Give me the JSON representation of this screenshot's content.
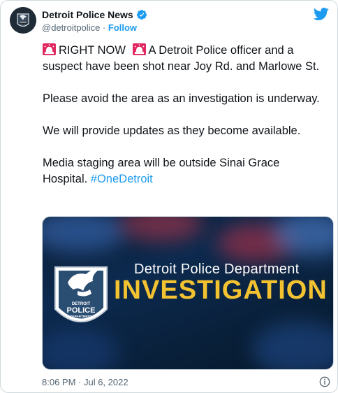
{
  "author": {
    "name": "Detroit Police News",
    "handle": "@detroitpolice",
    "separator": "·",
    "follow_label": "Follow",
    "avatar_icon": "detroit-police-badge-icon",
    "verified_icon": "verified-badge-icon"
  },
  "tweet": {
    "paragraphs": [
      "RIGHT NOW",
      "A Detroit Police officer and a suspect have been shot near Joy Rd. and Marlowe St.",
      "Please avoid the area as an investigation is underway.",
      "We will provide updates as they become available.",
      "Media staging area will be outside Sinai Grace Hospital."
    ],
    "hashtag": "#OneDetroit",
    "emoji": "police-car-light-icon"
  },
  "media": {
    "subtitle": "Detroit Police Department",
    "headline": "INVESTIGATION",
    "badge_line1": "DETROIT",
    "badge_line2": "POLICE",
    "badge_line3": "DEPARTMENT"
  },
  "footer": {
    "timestamp": "8:06 PM · Jul 6, 2022",
    "info_icon": "info-icon"
  },
  "colors": {
    "link": "#1d9bf0",
    "headline": "#f2c230",
    "media_bg": "#0c2a4f"
  }
}
